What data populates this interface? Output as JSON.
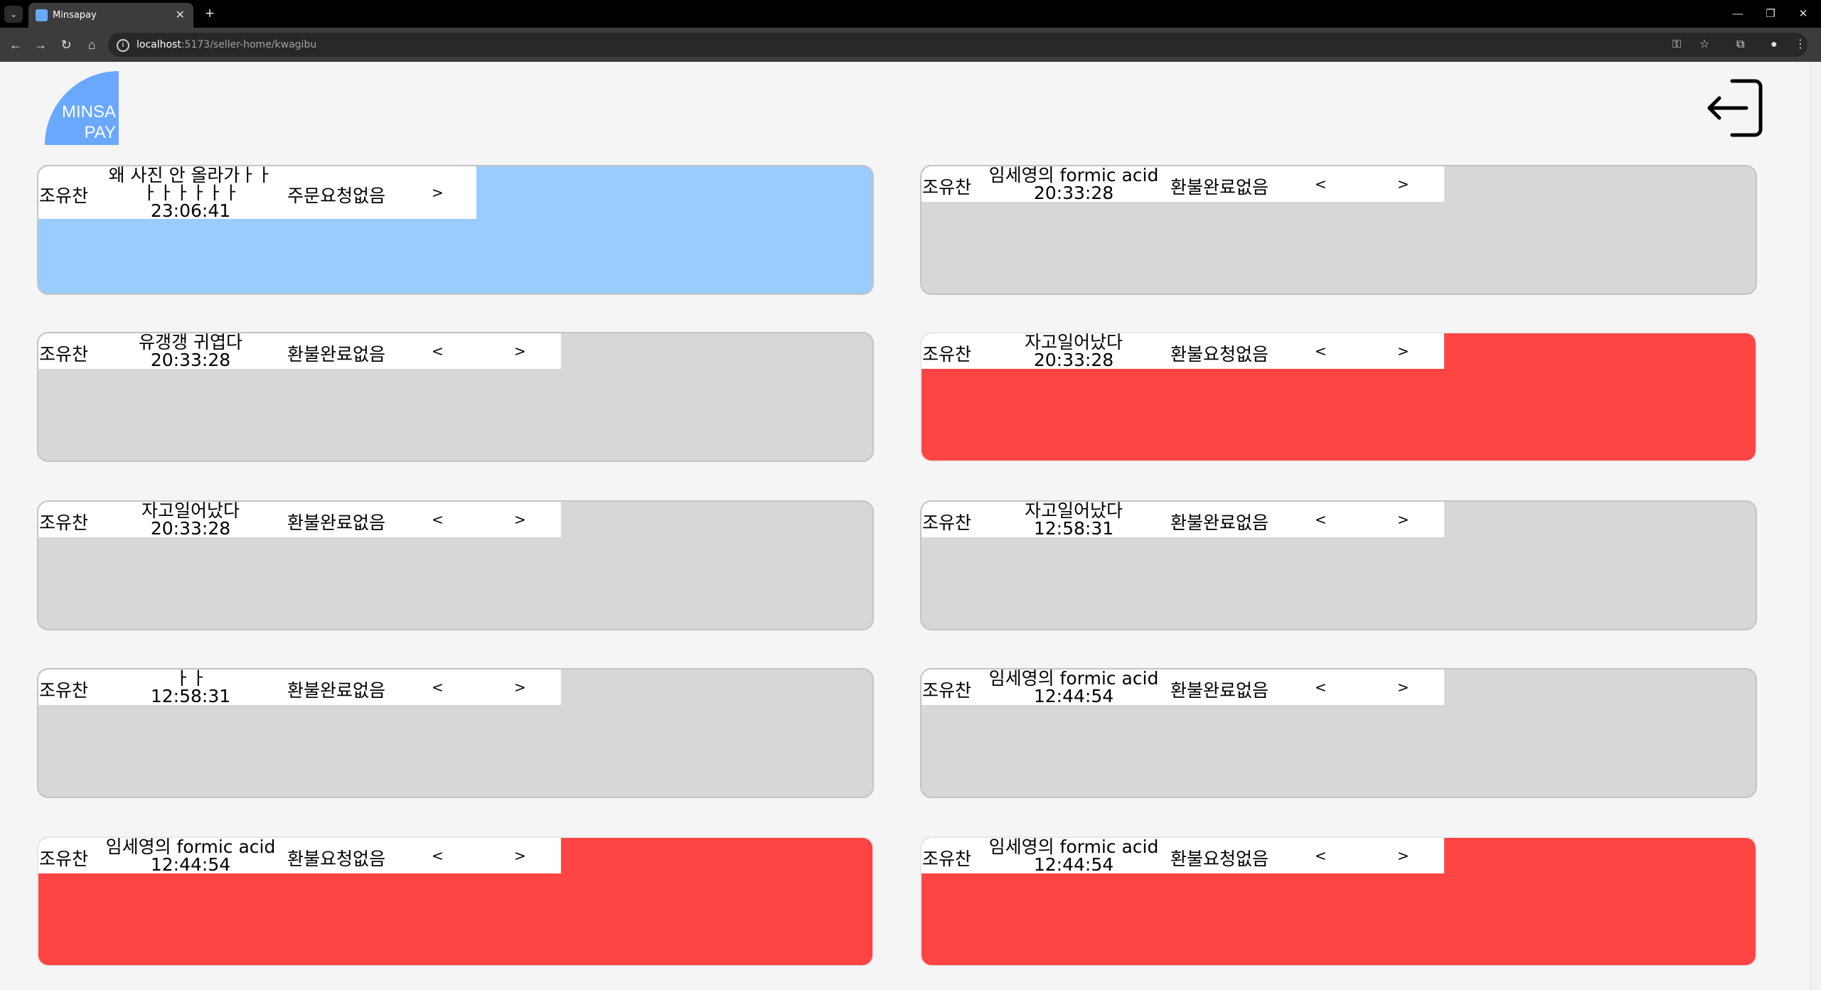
{
  "browser": {
    "tab_title": "Minsapay",
    "url_host": "localhost",
    "url_rest": ":5173/seller-home/kwagibu"
  },
  "logo": {
    "line1": "MINSA",
    "line2": "PAY"
  },
  "colors": {
    "pending": "#99ccff",
    "refund_requested": "#ff4444",
    "normal": "#d7d7d7"
  },
  "orders": [
    {
      "buyer": "조유찬",
      "product": "왜 사진 안 올라가ㅏㅏ ㅏㅏㅏㅏㅏㅏ",
      "time": "23:06:41",
      "status": "주문요청없음",
      "prev": "",
      "next": ">",
      "state": "blue"
    },
    {
      "buyer": "조유찬",
      "product": "임세영의 formic acid",
      "time": "20:33:28",
      "status": "환불완료없음",
      "prev": "<",
      "next": ">",
      "state": "gray"
    },
    {
      "buyer": "조유찬",
      "product": "유갱갱 귀엽다",
      "time": "20:33:28",
      "status": "환불완료없음",
      "prev": "<",
      "next": ">",
      "state": "gray"
    },
    {
      "buyer": "조유찬",
      "product": "자고일어났다",
      "time": "20:33:28",
      "status": "환불요청없음",
      "prev": "<",
      "next": ">",
      "state": "red"
    },
    {
      "buyer": "조유찬",
      "product": "자고일어났다",
      "time": "20:33:28",
      "status": "환불완료없음",
      "prev": "<",
      "next": ">",
      "state": "gray"
    },
    {
      "buyer": "조유찬",
      "product": "자고일어났다",
      "time": "12:58:31",
      "status": "환불완료없음",
      "prev": "<",
      "next": ">",
      "state": "gray"
    },
    {
      "buyer": "조유찬",
      "product": "ㅏㅏ",
      "time": "12:58:31",
      "status": "환불완료없음",
      "prev": "<",
      "next": ">",
      "state": "gray"
    },
    {
      "buyer": "조유찬",
      "product": "임세영의 formic acid",
      "time": "12:44:54",
      "status": "환불완료없음",
      "prev": "<",
      "next": ">",
      "state": "gray"
    },
    {
      "buyer": "조유찬",
      "product": "임세영의 formic acid",
      "time": "12:44:54",
      "status": "환불요청없음",
      "prev": "<",
      "next": ">",
      "state": "red"
    },
    {
      "buyer": "조유찬",
      "product": "임세영의 formic acid",
      "time": "12:44:54",
      "status": "환불요청없음",
      "prev": "<",
      "next": ">",
      "state": "red"
    }
  ]
}
